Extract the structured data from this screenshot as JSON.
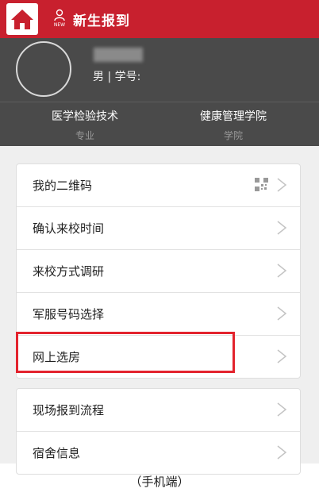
{
  "header": {
    "title": "新生报到",
    "new_badge": "NEW",
    "colors": {
      "bar": "#c8202e",
      "home_bg": "#ffffff"
    }
  },
  "profile": {
    "gender_id": "男 | 学号:",
    "major_value": "医学检验技术",
    "major_label": "专业",
    "college_value": "健康管理学院",
    "college_label": "学院",
    "colors": {
      "bg": "#4a4a4a"
    }
  },
  "menu_group1": [
    {
      "label": "我的二维码",
      "icon": "qr-code-icon"
    },
    {
      "label": "确认来校时间"
    },
    {
      "label": "来校方式调研"
    },
    {
      "label": "军服号码选择"
    },
    {
      "label": "网上选房",
      "highlighted": true
    }
  ],
  "menu_group2": [
    {
      "label": "现场报到流程"
    },
    {
      "label": "宿舍信息"
    }
  ],
  "caption": "（手机端）",
  "highlight_color": "#e3232d"
}
